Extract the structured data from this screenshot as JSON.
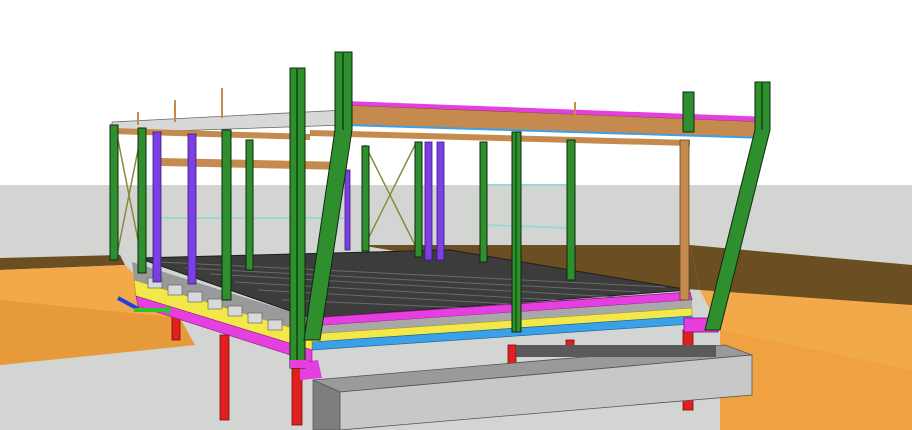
{
  "viewport": {
    "view_type": "3d-model-viewport",
    "scene": "steel-frame-structure-on-columns",
    "colors": {
      "sky": "#ffffff",
      "ground": "#d2d4d2",
      "terrain": "#f2a94a",
      "terrain_dark": "#6a4f22",
      "column": "#2f8f2f",
      "brace": "#7b3fe4",
      "beam_timber": "#c58a4e",
      "magenta_member": "#e63fe0",
      "yellow_member": "#f3e84a",
      "blue_member": "#3aa0e8",
      "deck": "#3c3c3c",
      "support_red": "#e02020",
      "concrete": "#8c8c8c"
    },
    "icons": [
      "axis-triad-icon"
    ]
  }
}
